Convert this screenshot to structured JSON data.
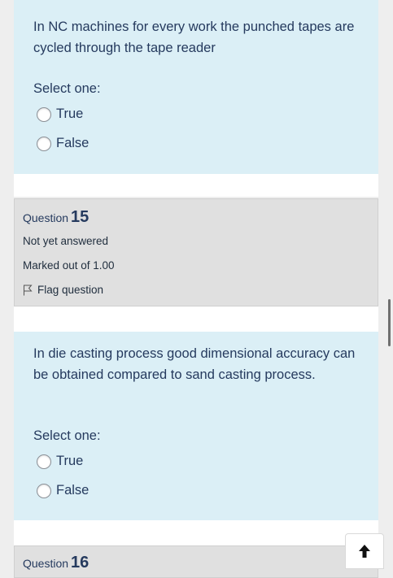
{
  "question14": {
    "text": "In NC machines for every work the punched tapes are cycled through the tape reader",
    "prompt": "Select one:",
    "options": [
      "True",
      "False"
    ]
  },
  "question15": {
    "label": "Question",
    "number": "15",
    "state": "Not yet answered",
    "marks": "Marked out of 1.00",
    "flag_label": "Flag question",
    "text": "In die casting process good dimensional accuracy can be obtained compared to sand casting process.",
    "prompt": "Select one:",
    "options": [
      "True",
      "False"
    ]
  },
  "question16": {
    "label": "Question",
    "number": "16"
  },
  "icons": {
    "flag": "flag-icon",
    "back_to_top": "arrow-up-icon"
  }
}
